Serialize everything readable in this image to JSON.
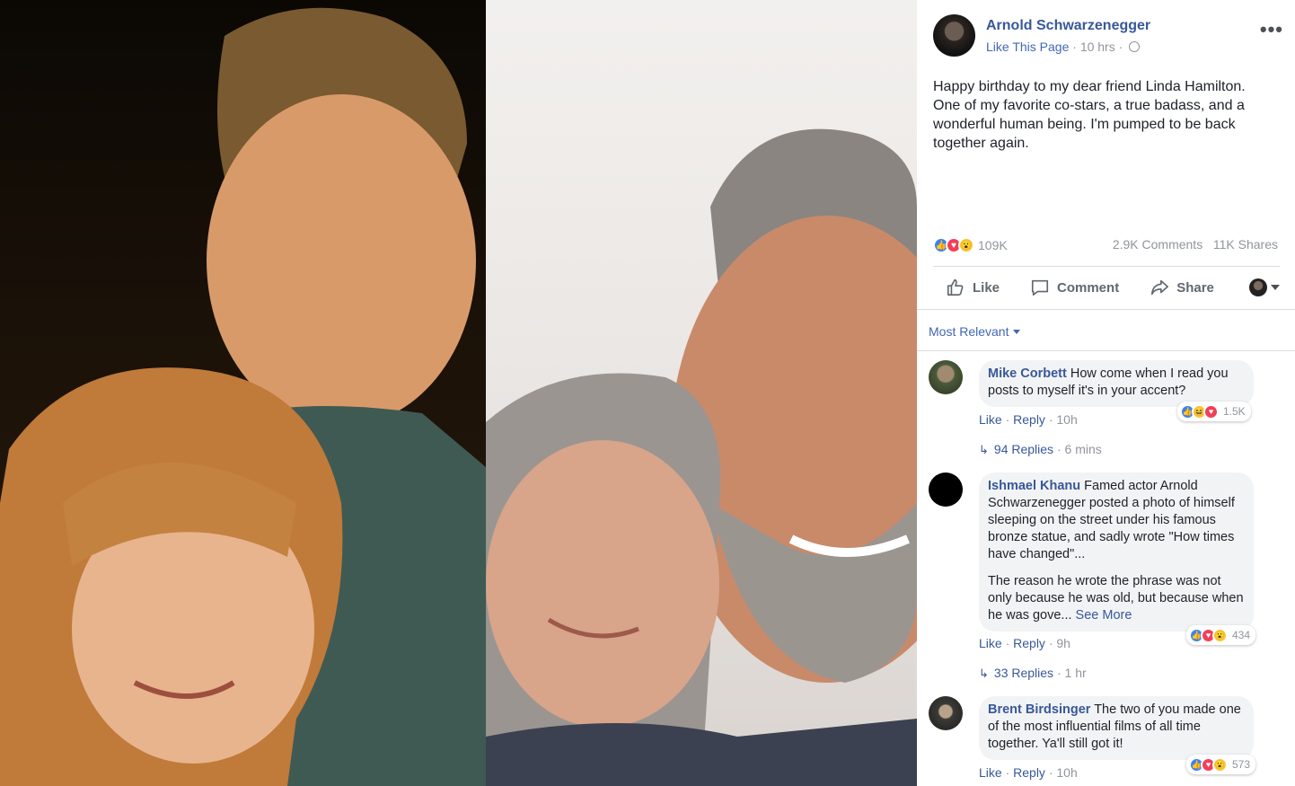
{
  "post": {
    "author": "Arnold Schwarzenegger",
    "like_page": "Like This Page",
    "time": "10 hrs",
    "sep": "·",
    "more_menu": "•••",
    "text": "Happy birthday to my dear friend Linda Hamilton. One of my favorite co-stars, a true badass, and a wonderful human being. I'm pumped to be back together again.",
    "reaction_count": "109K",
    "comments_count": "2.9K Comments",
    "shares_count": "11K Shares",
    "reaction_icons": [
      "like-icon",
      "love-icon",
      "wow-icon"
    ]
  },
  "actions": {
    "like": "Like",
    "comment": "Comment",
    "share": "Share"
  },
  "sort": {
    "label": "Most Relevant"
  },
  "comments": [
    {
      "name": "Mike Corbett",
      "text": "How come when I read you posts to myself it's in your accent?",
      "reactions": "1.5K",
      "like": "Like",
      "reply": "Reply",
      "time": "10h",
      "replies": "94 Replies",
      "replies_time": "6 mins"
    },
    {
      "name": "Ishmael Khanu",
      "text": "Famed actor Arnold Schwarzenegger posted a photo of himself sleeping on the street under his famous bronze statue, and sadly wrote \"How times have changed\"...",
      "text2": "The reason he wrote the phrase was not only because he was old, but because when he was gove...",
      "see_more": "See More",
      "reactions": "434",
      "like": "Like",
      "reply": "Reply",
      "time": "9h",
      "replies": "33 Replies",
      "replies_time": "1 hr"
    },
    {
      "name": "Brent Birdsinger",
      "text": "The two of you made one of the most influential films of all time together. Ya'll still got it!",
      "reactions": "573",
      "like": "Like",
      "reply": "Reply",
      "time": "10h"
    }
  ],
  "colors": {
    "link": "#385898",
    "accent": "#4267b2",
    "meta": "#90949c",
    "bubble": "#f2f3f5"
  }
}
